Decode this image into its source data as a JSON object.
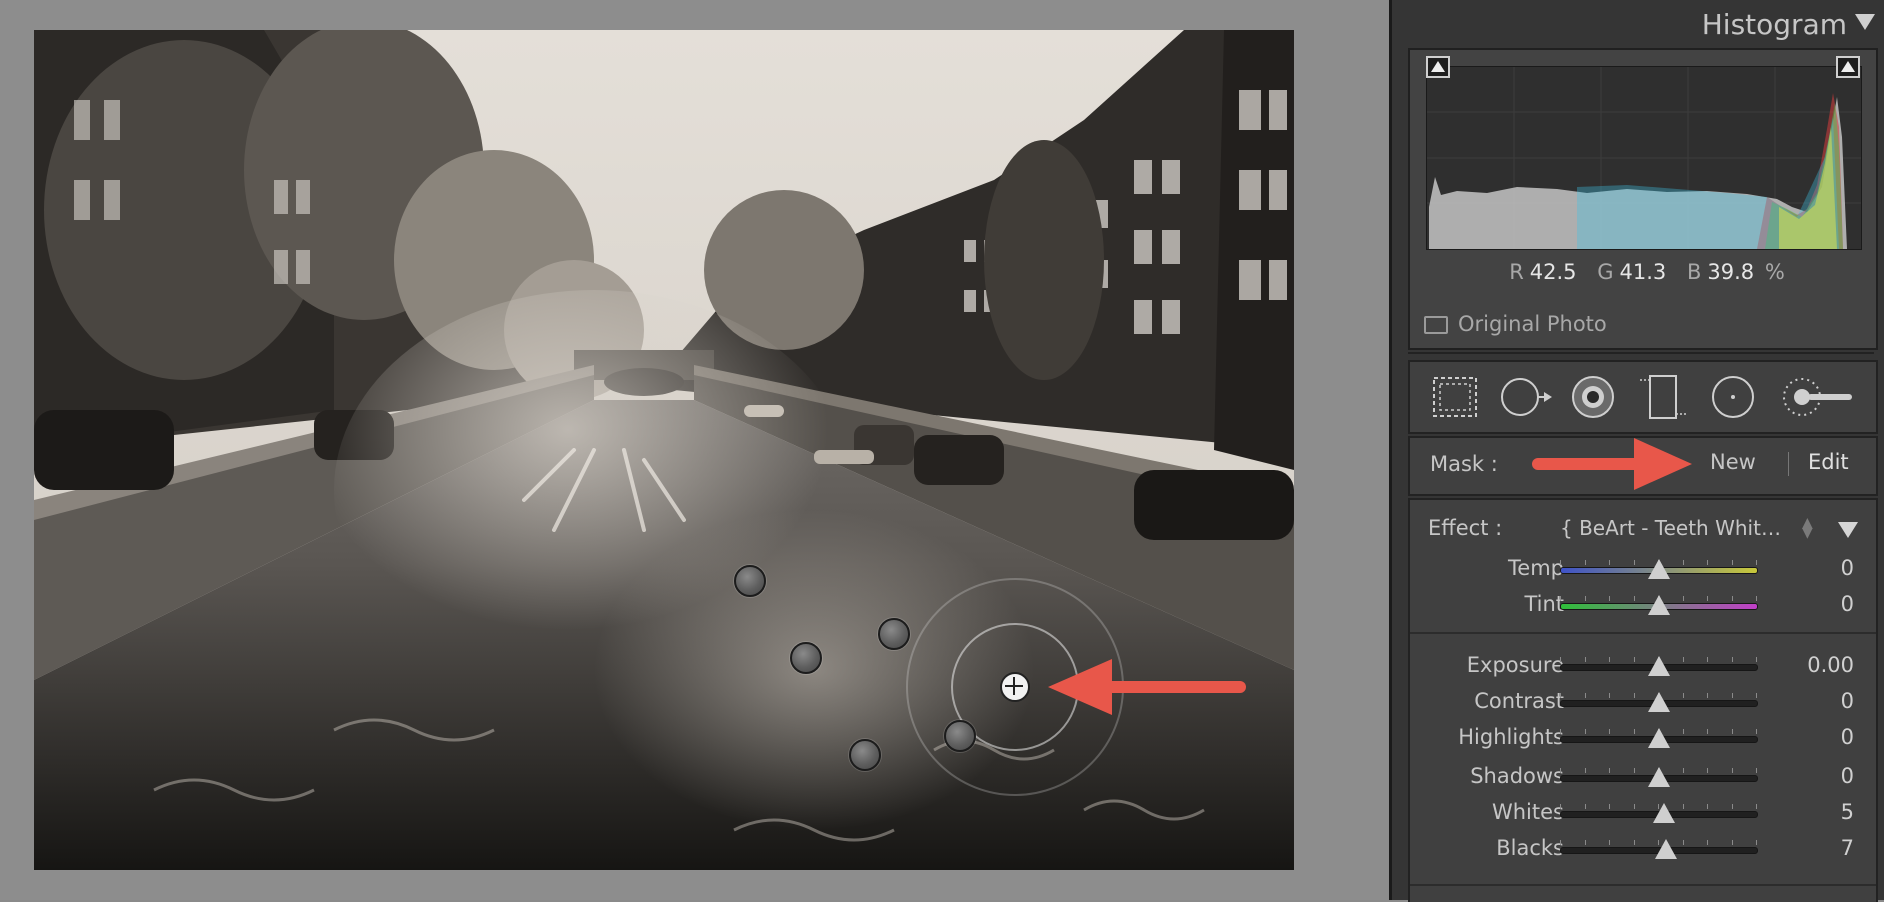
{
  "histogram": {
    "title": "Histogram",
    "rgb": {
      "r_label": "R",
      "r_value": "42.5",
      "g_label": "G",
      "g_value": "41.3",
      "b_label": "B",
      "b_value": "39.8",
      "unit": "%"
    },
    "original_photo_label": "Original Photo"
  },
  "tools": [
    "crop-overlay-icon",
    "spot-removal-icon",
    "red-eye-icon",
    "graduated-filter-icon",
    "radial-filter-icon",
    "adjustment-brush-icon"
  ],
  "mask": {
    "label": "Mask :",
    "new_label": "New",
    "edit_label": "Edit"
  },
  "effect": {
    "label": "Effect :",
    "preset": "{ BeArt - Teeth Whit…",
    "sliders": [
      {
        "name": "Temp",
        "value": "0",
        "position": 0.5,
        "track": "temp"
      },
      {
        "name": "Tint",
        "value": "0",
        "position": 0.5,
        "track": "tint"
      },
      {
        "name": "Exposure",
        "value": "0.00",
        "position": 0.5,
        "track": "plain"
      },
      {
        "name": "Contrast",
        "value": "0",
        "position": 0.5,
        "track": "plain"
      },
      {
        "name": "Highlights",
        "value": "0",
        "position": 0.5,
        "track": "plain"
      },
      {
        "name": "Shadows",
        "value": "0",
        "position": 0.5,
        "track": "plain"
      },
      {
        "name": "Whites",
        "value": "5",
        "position": 0.525,
        "track": "plain"
      },
      {
        "name": "Blacks",
        "value": "7",
        "position": 0.535,
        "track": "plain"
      }
    ]
  },
  "colors": {
    "panel_bg": "#353535",
    "annotation_arrow": "#e8574a",
    "temp_left": "#3f53c8",
    "temp_right": "#c8c83a",
    "tint_left": "#2fbf3a",
    "tint_right": "#c13fc8"
  }
}
